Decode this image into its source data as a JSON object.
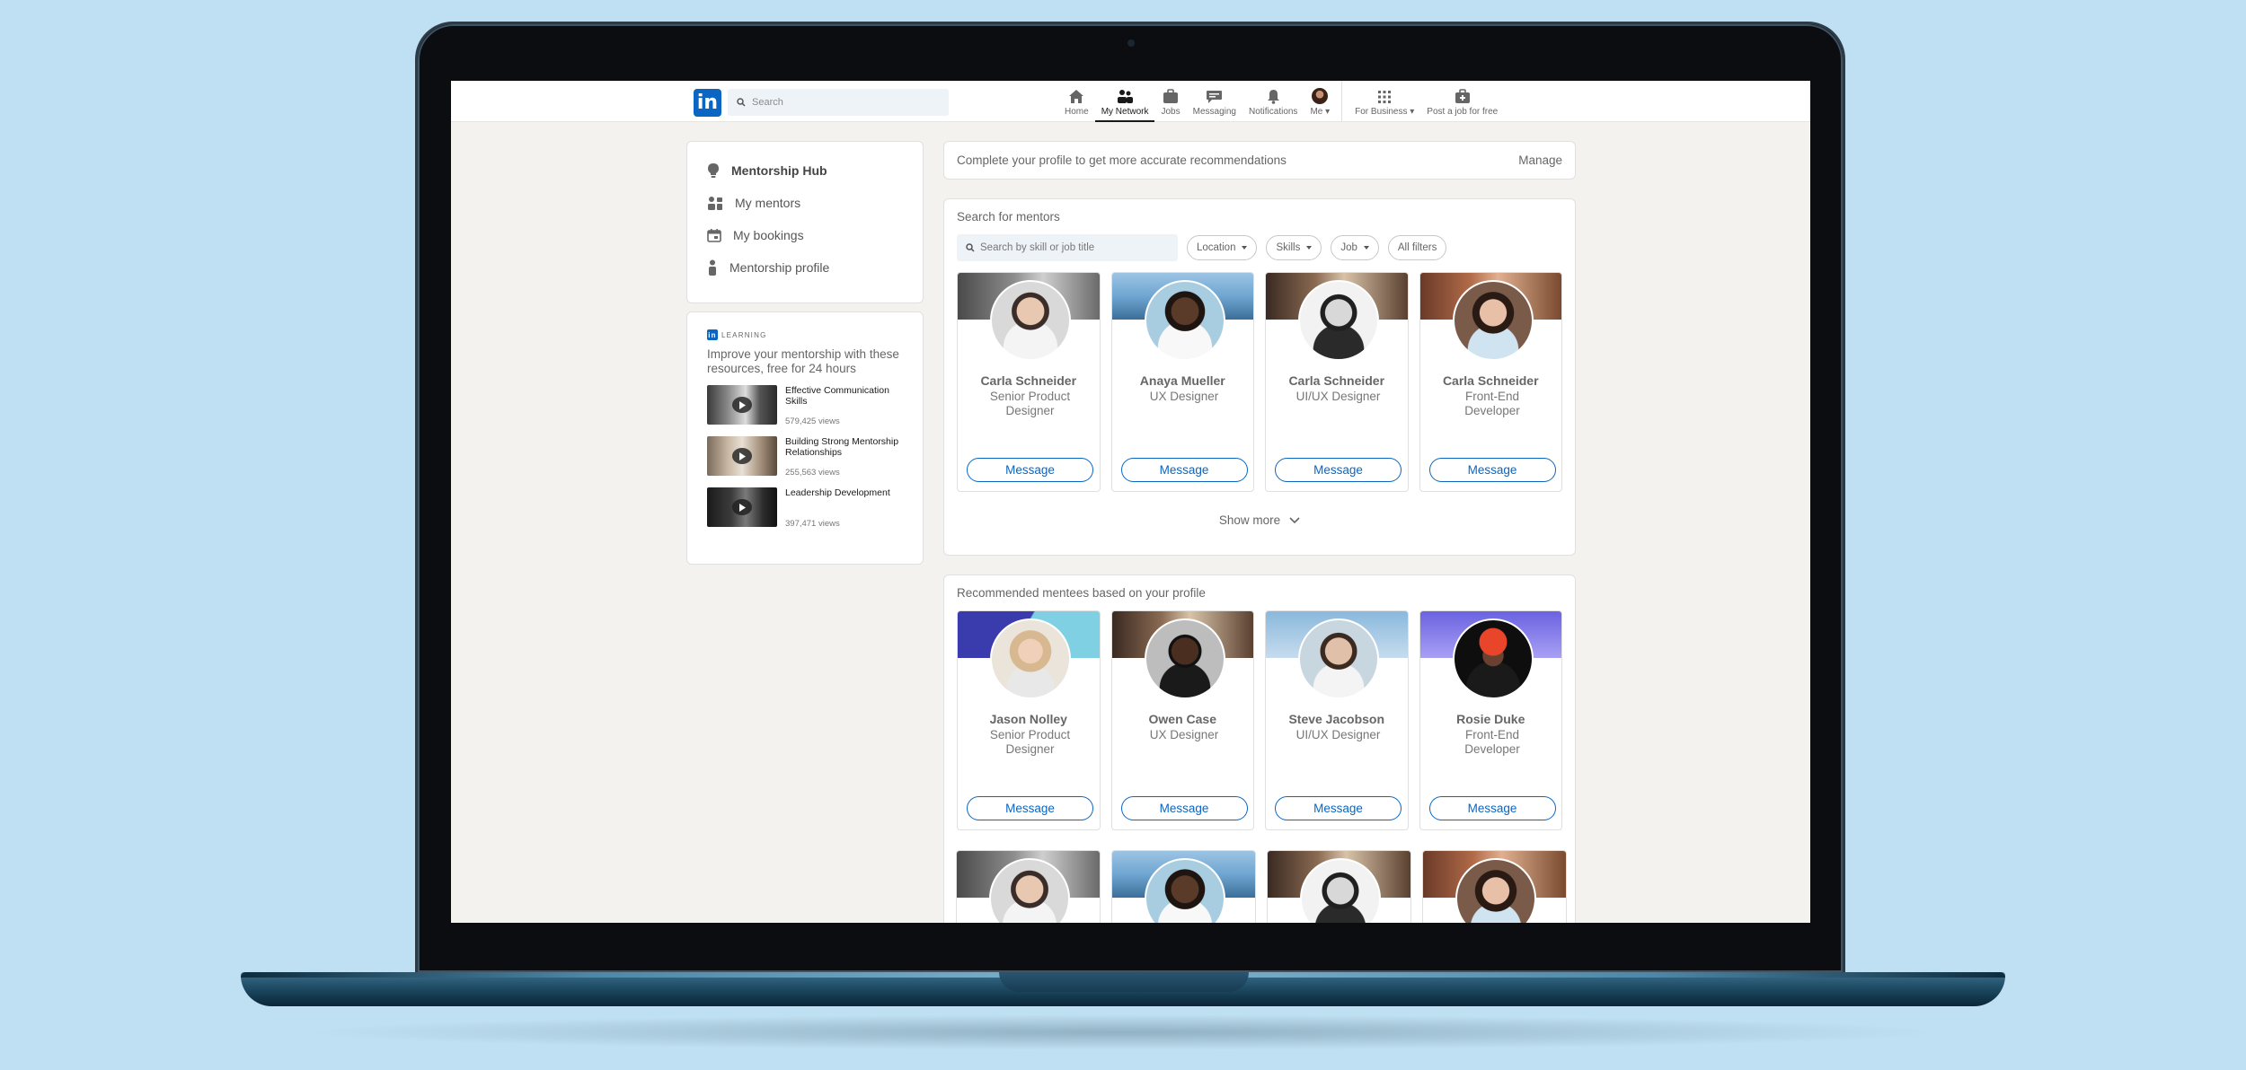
{
  "nav": {
    "logo": "in",
    "search_placeholder": "Search",
    "items": [
      {
        "label": "Home",
        "icon": "home-icon"
      },
      {
        "label": "My Network",
        "icon": "network-icon"
      },
      {
        "label": "Jobs",
        "icon": "briefcase-icon"
      },
      {
        "label": "Messaging",
        "icon": "message-icon"
      },
      {
        "label": "Notifications",
        "icon": "bell-icon"
      },
      {
        "label": "Me ▾",
        "icon": "avatar-icon"
      },
      {
        "label": "For Business ▾",
        "icon": "grid-icon"
      },
      {
        "label": "Post a job for free",
        "icon": "briefcase-plus-icon"
      }
    ],
    "active": "My Network"
  },
  "sidebar": {
    "items": [
      {
        "label": "Mentorship Hub"
      },
      {
        "label": "My mentors"
      },
      {
        "label": "My bookings"
      },
      {
        "label": "Mentorship profile"
      }
    ]
  },
  "learning": {
    "badge": "in",
    "heading": "LEARNING",
    "title": "Improve your mentorship with these resources, free for 24 hours",
    "courses": [
      {
        "title": "Effective Communication Skills",
        "views": "579,425 views"
      },
      {
        "title": "Building Strong Mentorship Relationships",
        "views": "255,563 views"
      },
      {
        "title": "Leadership Development",
        "views": "397,471 views"
      }
    ]
  },
  "banner": {
    "text": "Complete your profile to get more accurate recommendations",
    "action": "Manage"
  },
  "mentors": {
    "title": "Search for mentors",
    "search_placeholder": "Search by skill or job title",
    "filters": [
      "Location",
      "Skills",
      "Job",
      "All filters"
    ],
    "people": [
      {
        "name": "Carla Schneider",
        "role": "Senior Product Designer",
        "button": "Message"
      },
      {
        "name": "Anaya Mueller",
        "role": "UX Designer",
        "button": "Message"
      },
      {
        "name": "Carla Schneider",
        "role": "UI/UX Designer",
        "button": "Message"
      },
      {
        "name": "Carla Schneider",
        "role": "Front-End Developer",
        "button": "Message"
      }
    ],
    "show_more": "Show more"
  },
  "mentees": {
    "title": "Recommended mentees based on your profile",
    "people": [
      {
        "name": "Jason Nolley",
        "role": "Senior Product Designer",
        "button": "Message"
      },
      {
        "name": "Owen Case",
        "role": "UX Designer",
        "button": "Message"
      },
      {
        "name": "Steve Jacobson",
        "role": "UI/UX Designer",
        "button": "Message"
      },
      {
        "name": "Rosie Duke",
        "role": "Front-End Developer",
        "button": "Message"
      }
    ]
  },
  "colors": {
    "brand": "#0a66c2",
    "page_bg": "#f3f2ef",
    "backdrop": "#bfe0f2"
  }
}
